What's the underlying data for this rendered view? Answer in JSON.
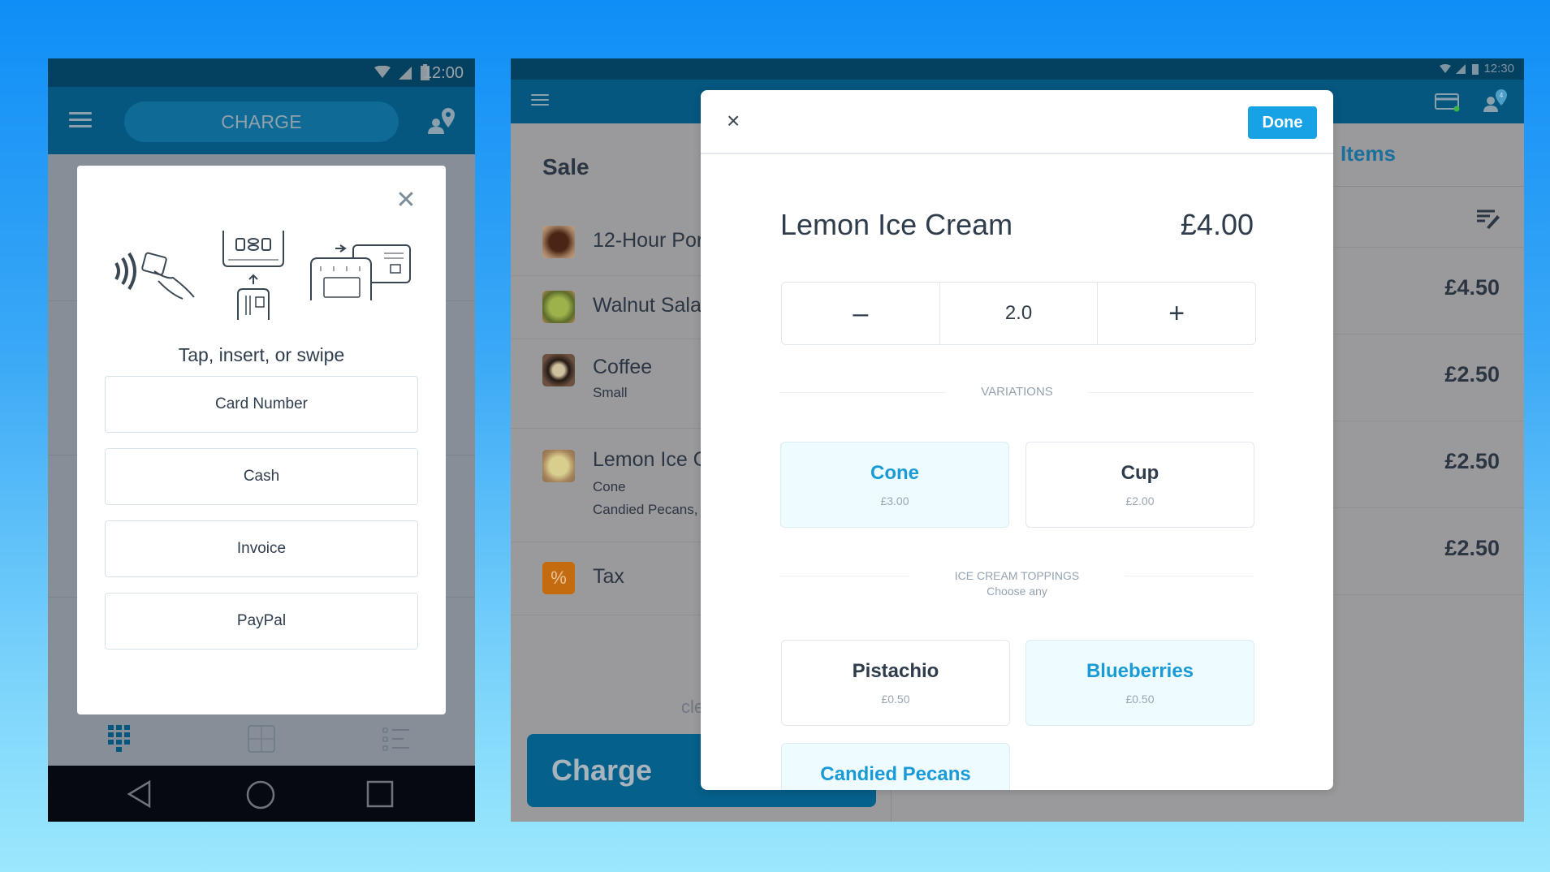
{
  "phone": {
    "status_time": "12:00",
    "app_bar": {
      "charge_label": "CHARGE",
      "menu_icon": "hamburger-menu-icon",
      "location_icon": "customer-location-icon"
    },
    "payment_modal": {
      "close_icon": "close-icon",
      "prompt": "Tap, insert, or swipe",
      "illustrations": [
        "contactless-tap",
        "chip-insert",
        "card-swipe"
      ],
      "buttons": [
        {
          "label": "Card Number"
        },
        {
          "label": "Cash"
        },
        {
          "label": "Invoice"
        },
        {
          "label": "PayPal"
        }
      ]
    },
    "tab_bar": [
      "keypad-icon",
      "calculator-icon",
      "list-icon"
    ],
    "nav_bar": [
      "back",
      "home",
      "recents"
    ]
  },
  "tablet": {
    "status_time": "12:30",
    "app_bar": {
      "menu_icon": "hamburger-menu-icon",
      "card_reader_icon": "card-reader-icon",
      "customer_badge": "4"
    },
    "sale": {
      "title": "Sale",
      "items": [
        {
          "name": "12-Hour Por",
          "sub": [],
          "thumb": "#6b3a26"
        },
        {
          "name": "Walnut Sala",
          "sub": [],
          "thumb": "#7a8c3a"
        },
        {
          "name": "Coffee",
          "sub": [
            "Small"
          ],
          "thumb": "#3a2c24"
        },
        {
          "name": "Lemon Ice C",
          "sub": [
            "Cone",
            "Candied Pecans,"
          ],
          "thumb": "#b08a4a"
        }
      ],
      "tax_label": "Tax",
      "tax_icon": "%",
      "clear_partial": "cle",
      "charge_label": "Charge"
    },
    "items_pane": {
      "tab_label": "Items",
      "prices": [
        "£4.50",
        "£2.50",
        "£2.50",
        "£2.50"
      ]
    }
  },
  "item_modal": {
    "close_icon": "×",
    "done_label": "Done",
    "title": "Lemon Ice Cream",
    "price": "£4.00",
    "quantity": {
      "minus": "–",
      "value": "2.0",
      "plus": "+"
    },
    "variations": {
      "label": "VARIATIONS",
      "options": [
        {
          "name": "Cone",
          "price": "£3.00",
          "selected": true
        },
        {
          "name": "Cup",
          "price": "£2.00",
          "selected": false
        }
      ]
    },
    "toppings": {
      "label": "ICE CREAM TOPPINGS",
      "sublabel": "Choose any",
      "options": [
        {
          "name": "Pistachio",
          "price": "£0.50",
          "selected": false
        },
        {
          "name": "Blueberries",
          "price": "£0.50",
          "selected": true
        },
        {
          "name": "Candied Pecans",
          "price": "",
          "selected": true
        }
      ]
    }
  },
  "colors": {
    "accent": "#16a2e4",
    "selected_text": "#1a9ad6",
    "app_bar": "#05577f",
    "status_bar": "#04405f",
    "tax_icon": "#c46a0f"
  }
}
